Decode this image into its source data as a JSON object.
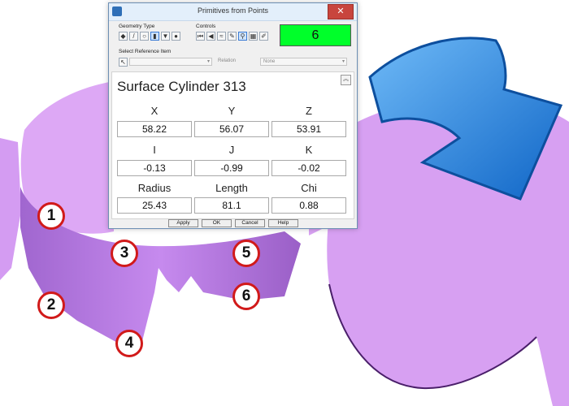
{
  "dialog": {
    "title": "Primitives from Points",
    "close_label": "✕",
    "geometry_type_label": "Geometry Type",
    "controls_label": "Controls",
    "count": "6",
    "select_reference_label": "Select Reference Item",
    "relation_label": "Relation",
    "relation_value": "None",
    "feature_title": "Surface Cylinder 313",
    "columns_row1": [
      "X",
      "Y",
      "Z"
    ],
    "values_row1": [
      "58.22",
      "56.07",
      "53.91"
    ],
    "columns_row2": [
      "I",
      "J",
      "K"
    ],
    "values_row2": [
      "-0.13",
      "-0.99",
      "-0.02"
    ],
    "columns_row3": [
      "Radius",
      "Length",
      "Chi"
    ],
    "values_row3": [
      "25.43",
      "81.1",
      "0.88"
    ],
    "buttons": {
      "apply": "Apply",
      "ok": "OK",
      "cancel": "Cancel",
      "help": "Help"
    }
  },
  "callouts": [
    "1",
    "2",
    "3",
    "4",
    "5",
    "6"
  ],
  "colors": {
    "mesh": "#d49cf2",
    "mesh_dark": "#7a4aa7",
    "arrow": "#1f80dc",
    "count_bg": "#00ff2a",
    "callout_ring": "#d11a1a"
  }
}
